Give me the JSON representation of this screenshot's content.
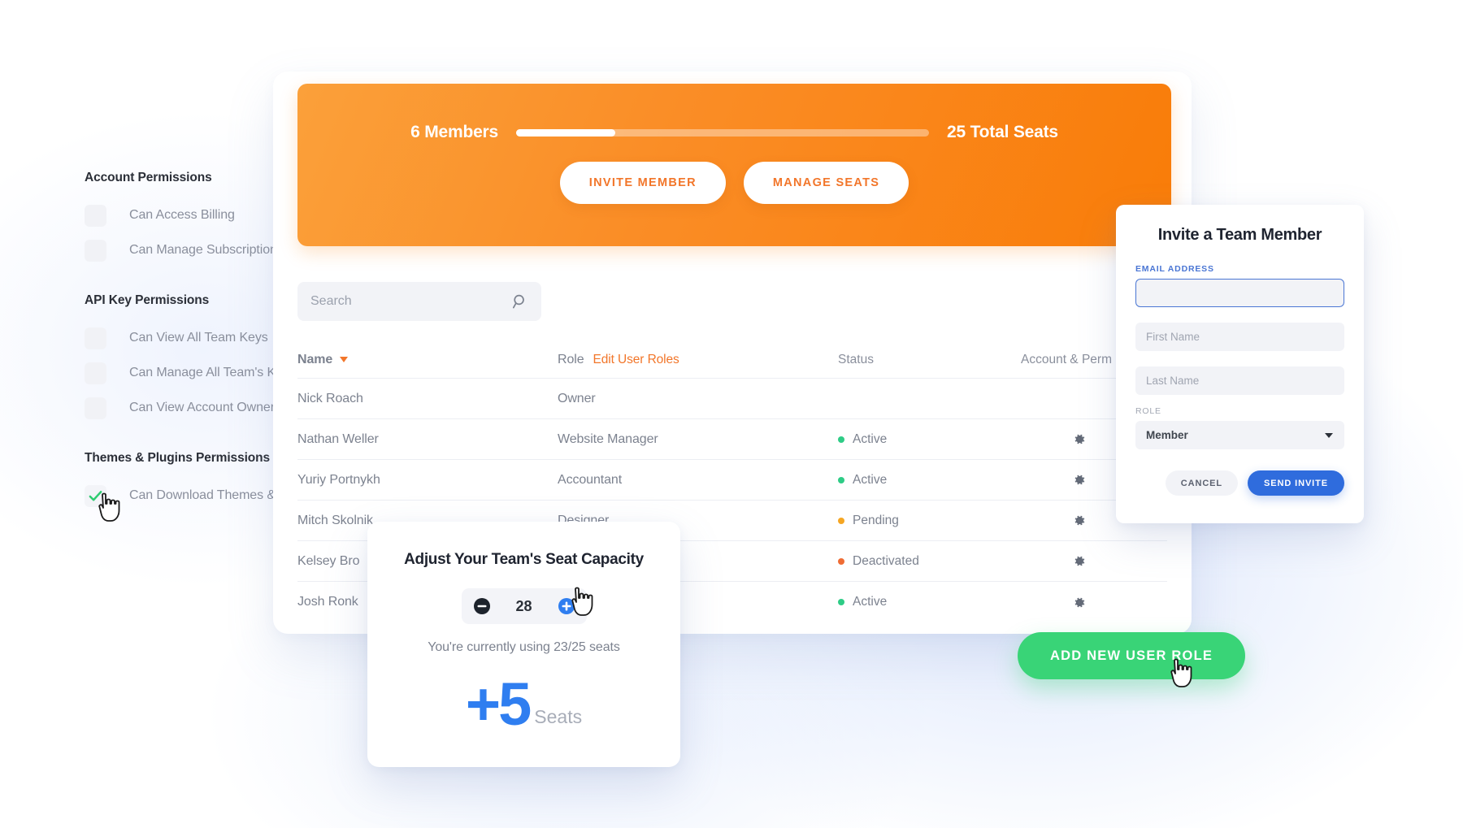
{
  "colors": {
    "orange": "#f97c08",
    "orange_text": "#f2762a",
    "blue": "#2f6cdd",
    "blue_bright": "#2f7ef0",
    "green": "#39d477",
    "status_active": "#2ecc86",
    "status_pending": "#f5a623",
    "status_deactivated": "#ef6c34",
    "muted_text": "#8a8f9c"
  },
  "permissions_panel": {
    "groups": [
      {
        "title": "Account Permissions",
        "items": [
          {
            "label": "Can Access Billing",
            "checked": false
          },
          {
            "label": "Can Manage Subscriptions",
            "checked": false
          }
        ]
      },
      {
        "title": "API Key Permissions",
        "items": [
          {
            "label": "Can View All Team Keys",
            "checked": false
          },
          {
            "label": "Can Manage All Team's Keys",
            "checked": false
          },
          {
            "label": "Can View Account Owner's K",
            "checked": false
          }
        ]
      },
      {
        "title": "Themes & Plugins Permissions",
        "items": [
          {
            "label": "Can Download Themes & Plug",
            "checked": true
          }
        ]
      }
    ]
  },
  "banner": {
    "members_label": "6 Members",
    "total_seats_label": "25 Total Seats",
    "members_count": 6,
    "total_seats": 25,
    "progress_percent": 24,
    "invite_button": "INVITE MEMBER",
    "manage_button": "MANAGE SEATS"
  },
  "search": {
    "placeholder": "Search",
    "value": "",
    "icon": "search-icon"
  },
  "table": {
    "columns": {
      "name": "Name",
      "role": "Role",
      "edit_roles_link": "Edit User Roles",
      "status": "Status",
      "account": "Account & Perm"
    },
    "sort_indicator": "caret-down-icon",
    "rows": [
      {
        "name": "Nick Roach",
        "role": "Owner",
        "status": "",
        "status_color": "",
        "gear": false
      },
      {
        "name": "Nathan Weller",
        "role": "Website Manager",
        "status": "Active",
        "status_color": "#2ecc86",
        "gear": true
      },
      {
        "name": "Yuriy Portnykh",
        "role": "Accountant",
        "status": "Active",
        "status_color": "#2ecc86",
        "gear": true
      },
      {
        "name": "Mitch Skolnik",
        "role": "Designer",
        "status": "Pending",
        "status_color": "#f5a623",
        "gear": true
      },
      {
        "name": "Kelsey Bro",
        "role": "",
        "status": "Deactivated",
        "status_color": "#ef6c34",
        "gear": true
      },
      {
        "name": "Josh Ronk",
        "role": "",
        "status": "Active",
        "status_color": "#2ecc86",
        "gear": true
      }
    ]
  },
  "invite_modal": {
    "title": "Invite a Team Member",
    "email_label": "EMAIL ADDRESS",
    "email_value": "",
    "email_placeholder": "",
    "first_name_placeholder": "First Name",
    "first_name_value": "",
    "last_name_placeholder": "Last Name",
    "last_name_value": "",
    "role_label": "ROLE",
    "role_value": "Member",
    "cancel_button": "CANCEL",
    "send_button": "SEND INVITE"
  },
  "seat_popup": {
    "title": "Adjust Your Team's Seat Capacity",
    "value": "28",
    "minus_icon": "minus-circle-icon",
    "plus_icon": "plus-circle-icon",
    "usage_text": "You're currently using 23/25 seats",
    "delta": "+5",
    "delta_unit": "Seats"
  },
  "cta": {
    "add_role_button": "ADD NEW USER ROLE"
  }
}
